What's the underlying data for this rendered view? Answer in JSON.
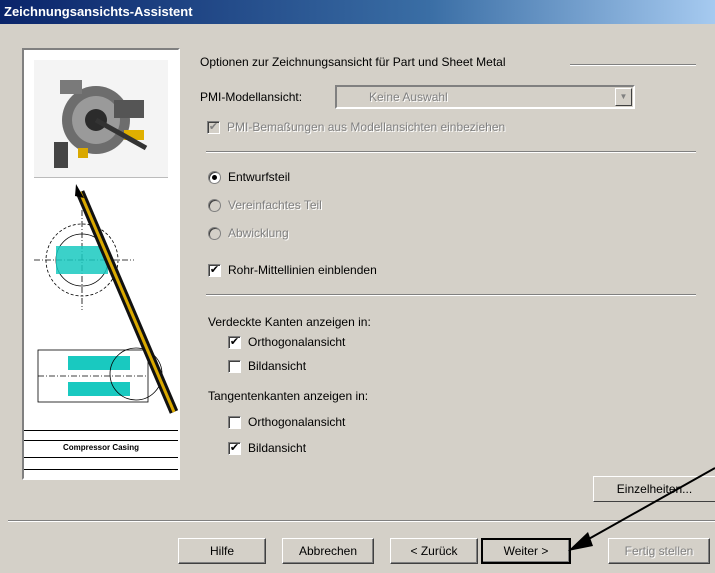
{
  "window": {
    "title": "Zeichnungsansichts-Assistent"
  },
  "preview": {
    "titleblock_name": "Compressor Casing"
  },
  "options": {
    "group_title": "Optionen zur Zeichnungsansicht für Part und Sheet Metal",
    "pmi_label": "PMI-Modellansicht:",
    "pmi_value": "Keine Auswahl",
    "pmi_include_label": "PMI-Bemaßungen aus Modellansichten einbeziehen",
    "pmi_include_checked": true
  },
  "part_type": {
    "options": [
      {
        "label": "Entwurfsteil",
        "selected": true,
        "enabled": true
      },
      {
        "label": "Vereinfachtes Teil",
        "selected": false,
        "enabled": false
      },
      {
        "label": "Abwicklung",
        "selected": false,
        "enabled": false
      }
    ]
  },
  "centerlines": {
    "label": "Rohr-Mittellinien einblenden",
    "checked": true
  },
  "hidden_edges": {
    "title": "Verdeckte Kanten anzeigen in:",
    "ortho_label": "Orthogonalansicht",
    "ortho_checked": true,
    "pictorial_label": "Bildansicht",
    "pictorial_checked": false
  },
  "tangent_edges": {
    "title": "Tangentenkanten anzeigen in:",
    "ortho_label": "Orthogonalansicht",
    "ortho_checked": false,
    "pictorial_label": "Bildansicht",
    "pictorial_checked": true
  },
  "buttons": {
    "details": "Einzelheiten...",
    "help": "Hilfe",
    "cancel": "Abbrechen",
    "back": "< Zurück",
    "next": "Weiter >",
    "finish": "Fertig stellen"
  },
  "check_mark": "✔"
}
